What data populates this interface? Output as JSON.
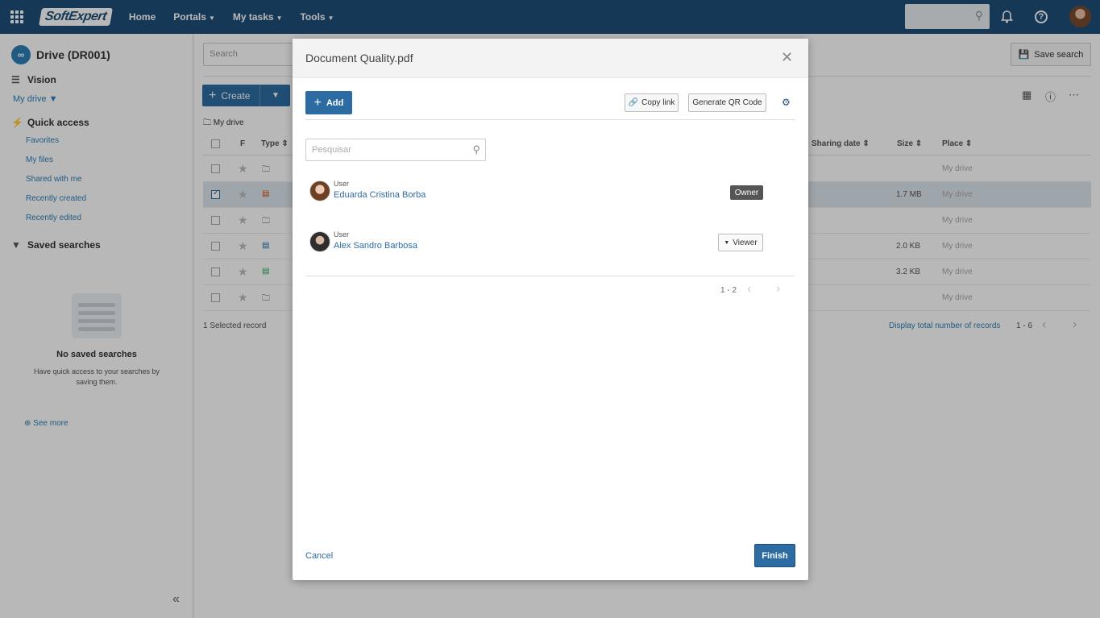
{
  "topbar": {
    "logo": "SoftExpert",
    "nav": [
      {
        "label": "Home",
        "has_caret": false
      },
      {
        "label": "Portals",
        "has_caret": true
      },
      {
        "label": "My tasks",
        "has_caret": true
      },
      {
        "label": "Tools",
        "has_caret": true
      }
    ],
    "icons": [
      "apps-grid-icon",
      "search-icon",
      "bell-icon",
      "help-icon",
      "user-avatar"
    ]
  },
  "sidebar": {
    "title": "Drive (DR001)",
    "vision_label": "Vision",
    "vision_select": "My drive",
    "quick_access_label": "Quick access",
    "quick_links": [
      "Favorites",
      "My files",
      "Shared with me",
      "Recently created",
      "Recently edited"
    ],
    "saved_searches_label": "Saved searches",
    "empty_title": "No saved searches",
    "empty_desc": "Have quick access to your searches by saving them.",
    "see_more": "See more"
  },
  "main": {
    "search_placeholder": "Search",
    "save_search": "Save search",
    "create": "Create",
    "breadcrumb": "My drive",
    "columns": {
      "f": "F",
      "type": "Type",
      "sharing_date": "Sharing date",
      "size": "Size",
      "place": "Place"
    },
    "rows": [
      {
        "type": "folder",
        "size": "",
        "place": "My drive",
        "selected": false
      },
      {
        "type": "pdf",
        "size": "1.7 MB",
        "place": "My drive",
        "selected": true
      },
      {
        "type": "folder",
        "size": "",
        "place": "My drive",
        "selected": false
      },
      {
        "type": "rtf",
        "size": "2.0 KB",
        "place": "My drive",
        "selected": false
      },
      {
        "type": "png",
        "size": "3.2 KB",
        "place": "My drive",
        "selected": false
      },
      {
        "type": "folder",
        "size": "",
        "place": "My drive",
        "selected": false
      }
    ],
    "selected_count": "1 Selected record",
    "display_total": "Display total number of records",
    "pagination": "1 - 6"
  },
  "modal": {
    "title": "Document Quality.pdf",
    "add": "Add",
    "copy_link": "Copy link",
    "qr_code": "Generate QR Code",
    "search_placeholder": "Pesquisar",
    "users": [
      {
        "kind": "User",
        "name": "Eduarda Cristina Borba",
        "role": "Owner"
      },
      {
        "kind": "User",
        "name": "Alex Sandro Barbosa",
        "role": "Viewer"
      }
    ],
    "pagination": "1 - 2",
    "cancel": "Cancel",
    "finish": "Finish"
  },
  "colors": {
    "topbar": "#1f4e79",
    "primary": "#2d6ca2",
    "link": "#2d7fb8"
  }
}
